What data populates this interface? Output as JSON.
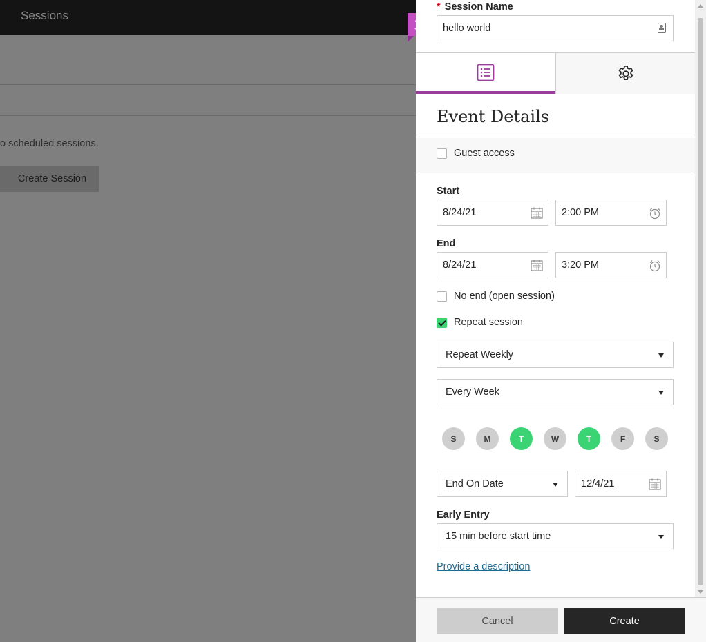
{
  "background": {
    "header_title": "Sessions",
    "no_sessions_text": "o scheduled sessions.",
    "create_session_label": "Create Session"
  },
  "panel": {
    "session_name_required": "*",
    "session_name_label": "Session Name",
    "session_name_value": "hello world",
    "tabs": [
      {
        "name": "event-details",
        "icon": "list-icon",
        "active": true
      },
      {
        "name": "settings",
        "icon": "gear-icon",
        "active": false
      }
    ],
    "section_title": "Event Details",
    "guest_access_label": "Guest access",
    "guest_access_checked": false,
    "start_label": "Start",
    "start_date": "8/24/21",
    "start_time": "2:00 PM",
    "end_label": "End",
    "end_date": "8/24/21",
    "end_time": "3:20 PM",
    "no_end_label": "No end (open session)",
    "no_end_checked": false,
    "repeat_label": "Repeat session",
    "repeat_checked": true,
    "repeat_frequency": "Repeat Weekly",
    "repeat_interval": "Every Week",
    "days": [
      {
        "label": "S",
        "on": false
      },
      {
        "label": "M",
        "on": false
      },
      {
        "label": "T",
        "on": true
      },
      {
        "label": "W",
        "on": false
      },
      {
        "label": "T",
        "on": true
      },
      {
        "label": "F",
        "on": false
      },
      {
        "label": "S",
        "on": false
      }
    ],
    "end_mode": "End On Date",
    "end_on_date": "12/4/21",
    "early_entry_label": "Early Entry",
    "early_entry_value": "15 min before start time",
    "description_link": "Provide a description",
    "cancel_label": "Cancel",
    "create_label": "Create"
  },
  "colors": {
    "accent_purple": "#9b3d9a",
    "close_bg": "#c44fc2",
    "day_on_green": "#3bd475",
    "link_blue": "#1d6b94"
  }
}
